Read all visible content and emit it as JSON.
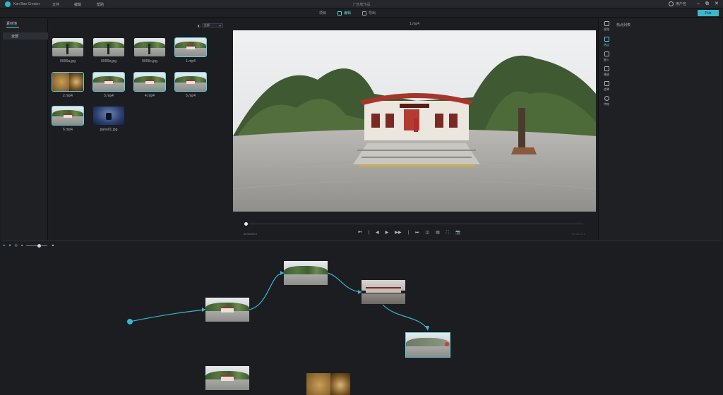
{
  "app": {
    "name": "Kan Bao Creator",
    "menus": [
      "文件",
      "编辑",
      "帮助"
    ],
    "file_title": "广告牌作品",
    "user": "用户名",
    "window_buttons": [
      "–",
      "⧉",
      "✕"
    ]
  },
  "modes": [
    {
      "label": "项目",
      "icon": "folder-icon",
      "active": false
    },
    {
      "label": "编辑",
      "icon": "edit-icon",
      "active": true
    },
    {
      "label": "导出",
      "icon": "export-icon",
      "active": false
    }
  ],
  "publish_label": "Pub",
  "library": {
    "tab_label": "素材池",
    "category": "全部",
    "filter_label": "全部",
    "items": [
      {
        "name": "0006a.jpg",
        "kind": "tripod",
        "selected": false
      },
      {
        "name": "0006b.jpg",
        "kind": "tripod",
        "selected": false
      },
      {
        "name": "0006c.jpg",
        "kind": "tripod",
        "selected": false
      },
      {
        "name": "1.mp4",
        "kind": "street",
        "selected": true
      },
      {
        "name": "2.mp4",
        "kind": "sphere",
        "selected": true
      },
      {
        "name": "3.mp4",
        "kind": "street",
        "selected": true
      },
      {
        "name": "4.mp4",
        "kind": "street",
        "selected": true
      },
      {
        "name": "5.mp4",
        "kind": "street",
        "selected": true
      },
      {
        "name": "6.mp4",
        "kind": "street",
        "selected": true
      },
      {
        "name": "pano01.jpg",
        "kind": "pano",
        "selected": false
      }
    ]
  },
  "preview": {
    "title": "1.mp4",
    "time_current": "00:00:00.0",
    "time_total": "00:00:18.0",
    "progress": 0.0,
    "controls": [
      "⏮",
      "|",
      "◀",
      "▶",
      "▶▶",
      "|",
      "⏭",
      "◫",
      "▤",
      "⛶",
      "📷"
    ]
  },
  "tools": [
    {
      "label": "视角",
      "active": false
    },
    {
      "label": "热点",
      "active": true
    },
    {
      "label": "嵌入",
      "active": false
    },
    {
      "label": "播放",
      "active": false
    },
    {
      "label": "遮罩",
      "active": false
    },
    {
      "label": "特效",
      "active": false
    }
  ],
  "hotspot_title": "热点列表",
  "graph": {
    "zoom_level": 0.55,
    "tool_icons": [
      "cursor-icon",
      "node-icon",
      "target-icon",
      "zoom-out-icon",
      "zoom-in-icon"
    ]
  },
  "colors": {
    "accent": "#5fd1e0",
    "publish": "#3ab7cc",
    "record": "#d23a3a",
    "background": "#1b1d21"
  }
}
